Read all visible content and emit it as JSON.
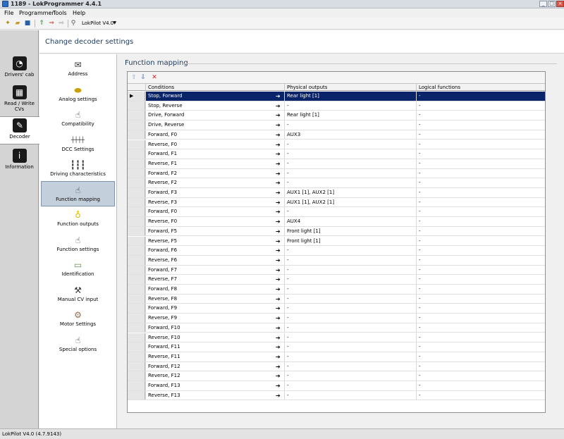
{
  "window": {
    "title": "1189 - LokProgrammer 4.4.1"
  },
  "menu": [
    "File",
    "Programmer",
    "Tools",
    "Help"
  ],
  "toolbar": {
    "decoder_combo": "LokPilot V4.0"
  },
  "leftnav": [
    {
      "label": "Drivers' cab",
      "icon": "gauge-icon"
    },
    {
      "label": "Read / Write CVs",
      "icon": "cv-icon"
    },
    {
      "label": "Decoder",
      "icon": "wrench-icon"
    },
    {
      "label": "Information",
      "icon": "info-icon"
    }
  ],
  "header": {
    "title": "Change decoder settings"
  },
  "subnav": [
    "Address",
    "Analog settings",
    "Compatibility",
    "DCC Settings",
    "Driving characteristics",
    "Function mapping",
    "Function outputs",
    "Function settings",
    "Identification",
    "Manual CV input",
    "Motor Settings",
    "Special options"
  ],
  "section": {
    "title": "Function mapping"
  },
  "grid": {
    "columns": [
      "Conditions",
      "Physical outputs",
      "Logical functions"
    ],
    "rows": [
      {
        "condition": "Stop, Forward",
        "physical": "Rear light [1]",
        "logical": "-"
      },
      {
        "condition": "Stop, Reverse",
        "physical": "-",
        "logical": "-"
      },
      {
        "condition": "Drive, Forward",
        "physical": "Rear light [1]",
        "logical": "-"
      },
      {
        "condition": "Drive, Reverse",
        "physical": "-",
        "logical": "-"
      },
      {
        "condition": "Forward, F0",
        "physical": "AUX3",
        "logical": "-"
      },
      {
        "condition": "Reverse, F0",
        "physical": "-",
        "logical": "-"
      },
      {
        "condition": "Forward, F1",
        "physical": "-",
        "logical": "-"
      },
      {
        "condition": "Reverse, F1",
        "physical": "-",
        "logical": "-"
      },
      {
        "condition": "Forward, F2",
        "physical": "-",
        "logical": "-"
      },
      {
        "condition": "Reverse, F2",
        "physical": "-",
        "logical": "-"
      },
      {
        "condition": "Forward, F3",
        "physical": "AUX1 [1], AUX2 [1]",
        "logical": "-"
      },
      {
        "condition": "Reverse, F3",
        "physical": "AUX1 [1], AUX2 [1]",
        "logical": "-"
      },
      {
        "condition": "Forward, F0",
        "physical": "-",
        "logical": "-"
      },
      {
        "condition": "Reverse, F0",
        "physical": "AUX4",
        "logical": "-"
      },
      {
        "condition": "Forward, F5",
        "physical": "Front light [1]",
        "logical": "-"
      },
      {
        "condition": "Reverse, F5",
        "physical": "Front light [1]",
        "logical": "-"
      },
      {
        "condition": "Forward, F6",
        "physical": "-",
        "logical": "-"
      },
      {
        "condition": "Reverse, F6",
        "physical": "-",
        "logical": "-"
      },
      {
        "condition": "Forward, F7",
        "physical": "-",
        "logical": "-"
      },
      {
        "condition": "Reverse, F7",
        "physical": "-",
        "logical": "-"
      },
      {
        "condition": "Forward, F8",
        "physical": "-",
        "logical": "-"
      },
      {
        "condition": "Reverse, F8",
        "physical": "-",
        "logical": "-"
      },
      {
        "condition": "Forward, F9",
        "physical": "-",
        "logical": "-"
      },
      {
        "condition": "Reverse, F9",
        "physical": "-",
        "logical": "-"
      },
      {
        "condition": "Forward, F10",
        "physical": "-",
        "logical": "-"
      },
      {
        "condition": "Reverse, F10",
        "physical": "-",
        "logical": "-"
      },
      {
        "condition": "Forward, F11",
        "physical": "-",
        "logical": "-"
      },
      {
        "condition": "Reverse, F11",
        "physical": "-",
        "logical": "-"
      },
      {
        "condition": "Forward, F12",
        "physical": "-",
        "logical": "-"
      },
      {
        "condition": "Reverse, F12",
        "physical": "-",
        "logical": "-"
      },
      {
        "condition": "Forward, F13",
        "physical": "-",
        "logical": "-"
      },
      {
        "condition": "Reverse, F13",
        "physical": "-",
        "logical": "-"
      }
    ]
  },
  "status": {
    "text": "LokPilot V4.0 (4.7.9143)"
  },
  "colors": {
    "selected_row": "#0a246a",
    "accent": "#1c3a5c"
  }
}
